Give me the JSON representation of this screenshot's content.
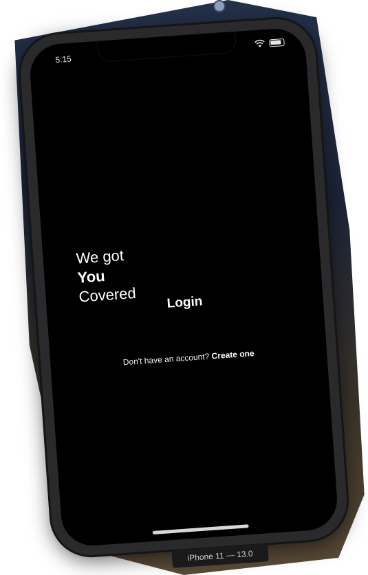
{
  "status_bar": {
    "time": "5:15",
    "icons": [
      "wifi-icon",
      "battery-icon"
    ]
  },
  "headline": {
    "line1": "We got",
    "line2": "You",
    "line3": "Covered"
  },
  "login": {
    "label": "Login"
  },
  "signup": {
    "prompt": "Don't have an account?",
    "link": "Create one"
  },
  "device_label": "iPhone 11 — 13.0",
  "colors": {
    "screen_background": "#000000",
    "text": "#ffffff",
    "device_frame": "#2a2a2c"
  }
}
